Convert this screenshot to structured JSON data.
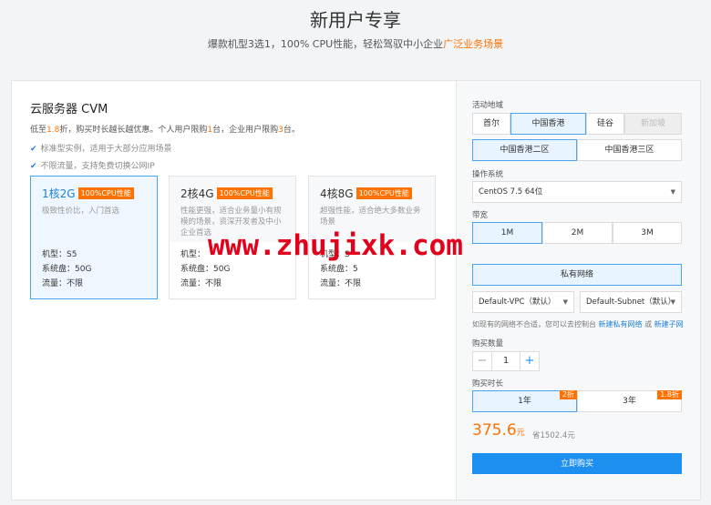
{
  "header": {
    "title": "新用户专享",
    "subtitle_prefix": "爆款机型3选1，100% CPU性能，轻松驾驭中小企业",
    "subtitle_highlight": "广泛业务场景"
  },
  "left": {
    "title": "云服务器 CVM",
    "promo": {
      "p1": "低至",
      "discount": "1.8",
      "p2": "折，购买时长越长越优惠。个人用户限购",
      "personal": "1",
      "p3": "台，企业用户限购",
      "enterprise": "3",
      "p4": "台。"
    },
    "features": [
      "标准型实例，适用于大部分应用场景",
      "不限流量，支持免费切换公网IP"
    ],
    "cards": [
      {
        "spec": "1核2G",
        "badge": "100%CPU性能",
        "desc": "极致性价比，入门首选",
        "model": "机型：S5",
        "disk": "系统盘：50G",
        "traffic": "流量：不限",
        "selected": true
      },
      {
        "spec": "2核4G",
        "badge": "100%CPU性能",
        "desc": "性能更强，适合业务量小有规模的场景，资深开发者及中小企业首选",
        "model": "机型：",
        "disk": "系统盘：50G",
        "traffic": "流量：不限",
        "selected": false
      },
      {
        "spec": "4核8G",
        "badge": "100%CPU性能",
        "desc": "超强性能，适合绝大多数业务场景",
        "model": "机型：S",
        "disk": "系统盘：5",
        "traffic": "流量：不限",
        "selected": false
      }
    ]
  },
  "right": {
    "region_label": "活动地域",
    "regions": [
      "首尔",
      "中国香港",
      "硅谷",
      "新加坡"
    ],
    "zones": [
      "中国香港二区",
      "中国香港三区"
    ],
    "os_label": "操作系统",
    "os_value": "CentOS 7.5 64位",
    "bandwidth_label": "带宽",
    "bandwidths": [
      "1M",
      "2M",
      "3M"
    ],
    "network": "私有网络",
    "vpc": "Default-VPC（默认）",
    "subnet": "Default-Subnet（默认）",
    "hint_text": "如现有的网络不合适，您可以去控制台",
    "hint_link1": "新建私有网络",
    "hint_or": "或",
    "hint_link2": "新建子网",
    "qty_label": "购买数量",
    "qty_minus": "−",
    "qty_value": "1",
    "qty_plus": "+",
    "duration_label": "购买时长",
    "durations": [
      {
        "label": "1年",
        "tag": "2折"
      },
      {
        "label": "3年",
        "tag": "1.8折"
      }
    ],
    "price": "375.6",
    "price_unit": "元",
    "save_text": "省1502.4元",
    "buy_label": "立即购买"
  },
  "watermark": "www.zhujixk.com",
  "colors": {
    "accent": "#1d8ff0",
    "highlight": "#ff7200",
    "watermark": "#e3001b"
  }
}
